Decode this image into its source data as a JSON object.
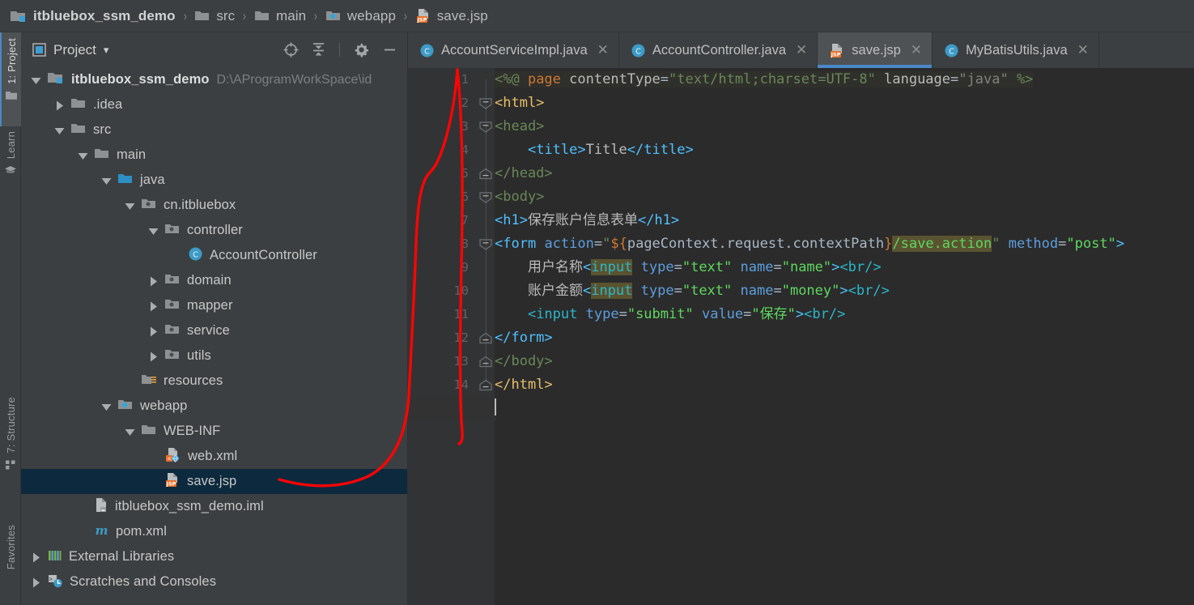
{
  "window": {
    "theme": "darcula",
    "accent_color": "#4a88c7",
    "editor_bg": "#2b2b2b",
    "panel_bg": "#3c3f41",
    "selection_bg": "#0d293e",
    "annotation_color": "#ff0000"
  },
  "breadcrumb": {
    "items": [
      {
        "label": "itbluebox_ssm_demo",
        "icon": "module-folder-icon"
      },
      {
        "label": "src",
        "icon": "folder-icon"
      },
      {
        "label": "main",
        "icon": "folder-icon"
      },
      {
        "label": "webapp",
        "icon": "webapp-folder-icon"
      },
      {
        "label": "save.jsp",
        "icon": "jsp-file-icon"
      }
    ],
    "separator": "›"
  },
  "tool_strip": {
    "buttons": [
      {
        "label": "1: Project",
        "icon": "project-folder-icon",
        "active": true
      },
      {
        "label": "Learn",
        "icon": "learn-graduation-icon",
        "active": false
      },
      {
        "label": "7: Structure",
        "icon": "structure-icon",
        "active": false
      },
      {
        "label": "Favorites",
        "icon": "favorites-icon",
        "active": false
      }
    ]
  },
  "project_panel": {
    "title": "Project",
    "dropdown_caret": "▾",
    "tools": [
      {
        "name": "locate-target-icon",
        "title": "Select Opened File"
      },
      {
        "name": "collapse-all-icon",
        "title": "Collapse All"
      },
      {
        "name": "gear-icon",
        "title": "Settings"
      },
      {
        "name": "minimize-icon",
        "title": "Hide"
      }
    ],
    "tree": [
      {
        "label": "itbluebox_ssm_demo",
        "path": "D:\\AProgramWorkSpace\\id",
        "depth": 0,
        "twisty": "down",
        "icon": "module-folder-icon",
        "selected": false,
        "bold": true
      },
      {
        "label": ".idea",
        "path": "",
        "depth": 1,
        "twisty": "right",
        "icon": "folder-icon",
        "selected": false,
        "bold": false
      },
      {
        "label": "src",
        "path": "",
        "depth": 1,
        "twisty": "down",
        "icon": "folder-icon",
        "selected": false,
        "bold": false
      },
      {
        "label": "main",
        "path": "",
        "depth": 2,
        "twisty": "down",
        "icon": "folder-icon",
        "selected": false,
        "bold": false
      },
      {
        "label": "java",
        "path": "",
        "depth": 3,
        "twisty": "down",
        "icon": "source-folder-icon",
        "selected": false,
        "bold": false
      },
      {
        "label": "cn.itbluebox",
        "path": "",
        "depth": 4,
        "twisty": "down",
        "icon": "package-icon",
        "selected": false,
        "bold": false
      },
      {
        "label": "controller",
        "path": "",
        "depth": 5,
        "twisty": "down",
        "icon": "package-icon",
        "selected": false,
        "bold": false
      },
      {
        "label": "AccountController",
        "path": "",
        "depth": 6,
        "twisty": "none",
        "icon": "java-class-icon",
        "selected": false,
        "bold": false
      },
      {
        "label": "domain",
        "path": "",
        "depth": 5,
        "twisty": "right",
        "icon": "package-icon",
        "selected": false,
        "bold": false
      },
      {
        "label": "mapper",
        "path": "",
        "depth": 5,
        "twisty": "right",
        "icon": "package-icon",
        "selected": false,
        "bold": false
      },
      {
        "label": "service",
        "path": "",
        "depth": 5,
        "twisty": "right",
        "icon": "package-icon",
        "selected": false,
        "bold": false
      },
      {
        "label": "utils",
        "path": "",
        "depth": 5,
        "twisty": "right",
        "icon": "package-icon",
        "selected": false,
        "bold": false
      },
      {
        "label": "resources",
        "path": "",
        "depth": 4,
        "twisty": "none",
        "icon": "resources-folder-icon",
        "selected": false,
        "bold": false
      },
      {
        "label": "webapp",
        "path": "",
        "depth": 3,
        "twisty": "down",
        "icon": "webapp-folder-icon",
        "selected": false,
        "bold": false
      },
      {
        "label": "WEB-INF",
        "path": "",
        "depth": 4,
        "twisty": "down",
        "icon": "folder-icon",
        "selected": false,
        "bold": false
      },
      {
        "label": "web.xml",
        "path": "",
        "depth": 5,
        "twisty": "none",
        "icon": "web-xml-icon",
        "selected": false,
        "bold": false
      },
      {
        "label": "save.jsp",
        "path": "",
        "depth": 5,
        "twisty": "none",
        "icon": "jsp-file-icon",
        "selected": true,
        "bold": false
      },
      {
        "label": "itbluebox_ssm_demo.iml",
        "path": "",
        "depth": 2,
        "twisty": "none",
        "icon": "iml-file-icon",
        "selected": false,
        "bold": false
      },
      {
        "label": "pom.xml",
        "path": "",
        "depth": 2,
        "twisty": "none",
        "icon": "maven-icon",
        "selected": false,
        "bold": false
      },
      {
        "label": "External Libraries",
        "path": "",
        "depth": 0,
        "twisty": "right",
        "icon": "libraries-icon",
        "selected": false,
        "bold": false
      },
      {
        "label": "Scratches and Consoles",
        "path": "",
        "depth": 0,
        "twisty": "right",
        "icon": "scratches-icon",
        "selected": false,
        "bold": false
      }
    ]
  },
  "editor": {
    "tabs": [
      {
        "label": "AccountServiceImpl.java",
        "icon": "java-class-icon",
        "active": false,
        "close": "✕"
      },
      {
        "label": "AccountController.java",
        "icon": "java-class-icon",
        "active": false,
        "close": "✕"
      },
      {
        "label": "save.jsp",
        "icon": "jsp-file-icon",
        "active": true,
        "close": "✕"
      },
      {
        "label": "MyBatisUtils.java",
        "icon": "java-class-icon",
        "active": false,
        "close": "✕"
      }
    ],
    "line_numbers": [
      "1",
      "2",
      "3",
      "4",
      "5",
      "6",
      "7",
      "8",
      "9",
      "10",
      "11",
      "12",
      "13",
      "14",
      "15"
    ],
    "current_line": 15,
    "fold_markers": [
      {
        "line": 2,
        "type": "open"
      },
      {
        "line": 3,
        "type": "open"
      },
      {
        "line": 5,
        "type": "close"
      },
      {
        "line": 6,
        "type": "open"
      },
      {
        "line": 8,
        "type": "open"
      },
      {
        "line": 12,
        "type": "close"
      },
      {
        "line": 13,
        "type": "close"
      },
      {
        "line": 14,
        "type": "close"
      }
    ],
    "code_lines": [
      {
        "n": 1,
        "text": "<%@ page contentType=\"text/html;charset=UTF-8\" language=\"java\" %>"
      },
      {
        "n": 2,
        "text": "<html>"
      },
      {
        "n": 3,
        "text": "<head>"
      },
      {
        "n": 4,
        "text": "    <title>Title</title>"
      },
      {
        "n": 5,
        "text": "</head>"
      },
      {
        "n": 6,
        "text": "<body>"
      },
      {
        "n": 7,
        "text": "<h1>保存账户信息表单</h1>"
      },
      {
        "n": 8,
        "text": "<form action=\"${pageContext.request.contextPath}/save.action\" method=\"post\">"
      },
      {
        "n": 9,
        "text": "    用户名称<input type=\"text\" name=\"name\"><br/>"
      },
      {
        "n": 10,
        "text": "    账户金额<input type=\"text\" name=\"money\"><br/>"
      },
      {
        "n": 11,
        "text": "    <input type=\"submit\" value=\"保存\"><br/>"
      },
      {
        "n": 12,
        "text": "</form>"
      },
      {
        "n": 13,
        "text": "</body>"
      },
      {
        "n": 14,
        "text": "</html>"
      },
      {
        "n": 15,
        "text": ""
      }
    ]
  },
  "annotation": {
    "shape": "hand-drawn-loop-arrow",
    "color": "#fb0404",
    "description": "red hand-drawn loop from save.jsp tree item up along the editor gutter"
  }
}
